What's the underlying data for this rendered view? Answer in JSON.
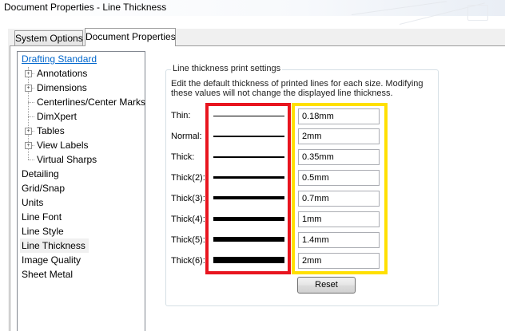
{
  "window": {
    "title": "Document Properties - Line Thickness"
  },
  "tabs": [
    {
      "label": "System Options"
    },
    {
      "label": "Document Properties"
    }
  ],
  "tree": {
    "items": [
      {
        "label": "Drafting Standard"
      },
      {
        "label": "Annotations"
      },
      {
        "label": "Dimensions"
      },
      {
        "label": "Centerlines/Center Marks"
      },
      {
        "label": "DimXpert"
      },
      {
        "label": "Tables"
      },
      {
        "label": "View Labels"
      },
      {
        "label": "Virtual Sharps"
      },
      {
        "label": "Detailing"
      },
      {
        "label": "Grid/Snap"
      },
      {
        "label": "Units"
      },
      {
        "label": "Line Font"
      },
      {
        "label": "Line Style"
      },
      {
        "label": "Line Thickness"
      },
      {
        "label": "Image Quality"
      },
      {
        "label": "Sheet Metal"
      }
    ],
    "expander_symbol": "+"
  },
  "group": {
    "legend": "Line thickness print settings",
    "description": "Edit the default thickness of printed lines for each size.  Modifying these values will not change the displayed line thickness."
  },
  "rows": [
    {
      "label": "Thin:",
      "value": "0.18mm"
    },
    {
      "label": "Normal:",
      "value": "2mm"
    },
    {
      "label": "Thick:",
      "value": "0.35mm"
    },
    {
      "label": "Thick(2):",
      "value": "0.5mm"
    },
    {
      "label": "Thick(3):",
      "value": "0.7mm"
    },
    {
      "label": "Thick(4):",
      "value": "1mm"
    },
    {
      "label": "Thick(5):",
      "value": "1.4mm"
    },
    {
      "label": "Thick(6):",
      "value": "2mm"
    }
  ],
  "buttons": {
    "reset": "Reset"
  },
  "colors": {
    "highlight_red": "#e8151f",
    "highlight_yellow": "#ffe000",
    "link_blue": "#0066cc"
  }
}
